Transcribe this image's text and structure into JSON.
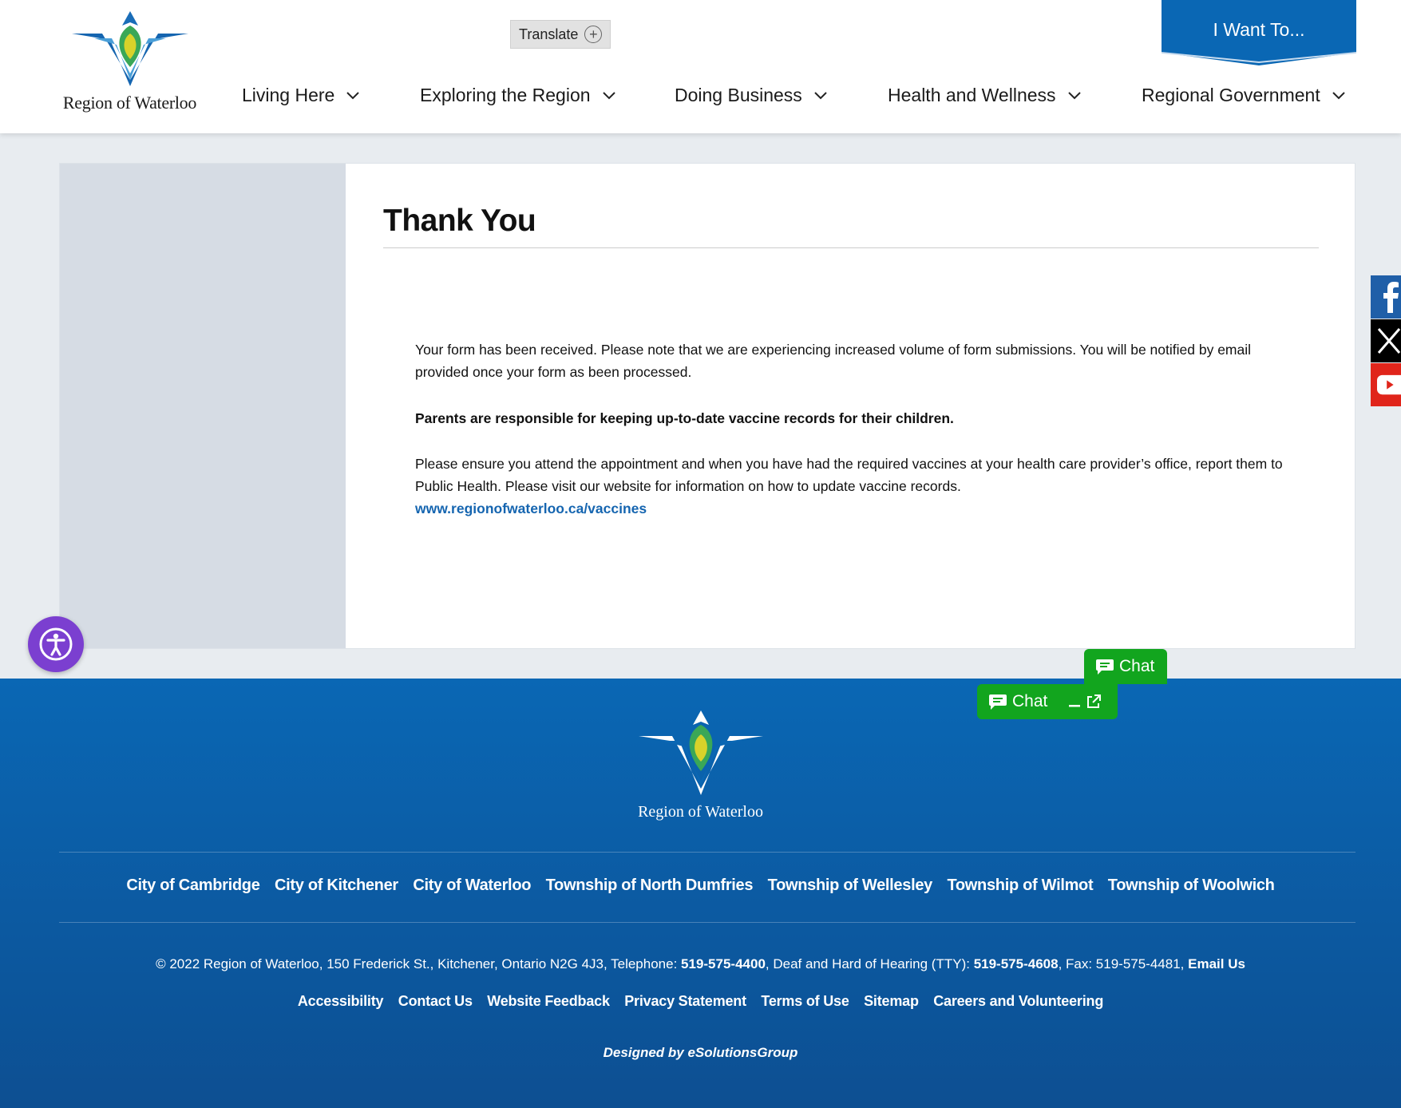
{
  "header": {
    "logo_text": "Region of Waterloo",
    "translate_label": "Translate",
    "i_want_label": "I Want To...",
    "nav": [
      {
        "label": "Living Here"
      },
      {
        "label": "Exploring the Region"
      },
      {
        "label": "Doing Business"
      },
      {
        "label": "Health and Wellness"
      },
      {
        "label": "Regional Government"
      }
    ]
  },
  "main": {
    "title": "Thank You",
    "paragraph1": "Your form has been received. Please note that we are experiencing increased volume of form submissions. You will be notified by email provided once your form as been processed.",
    "paragraph2": "Parents are responsible for keeping up-to-date vaccine records for their children.",
    "paragraph3": "Please ensure you attend the appointment and when you have had the required vaccines at your health care provider’s office, report them to Public Health. Please visit our website for information on how to update vaccine records.",
    "link": "www.regionofwaterloo.ca/vaccines"
  },
  "social": [
    {
      "icon": "facebook-icon",
      "color": "#1f5fa8"
    },
    {
      "icon": "x-icon",
      "color": "#000000"
    },
    {
      "icon": "youtube-icon",
      "color": "#e0251b"
    }
  ],
  "chat": {
    "label_top": "Chat",
    "label_bottom": "Chat"
  },
  "footer": {
    "logo_text": "Region of Waterloo",
    "municipalities": [
      "City of Cambridge",
      "City of Kitchener",
      "City of Waterloo",
      "Township of North Dumfries",
      "Township of Wellesley",
      "Township of Wilmot",
      "Township of Woolwich"
    ],
    "address": {
      "prefix": "© 2022 Region of Waterloo, 150 Frederick St., Kitchener, Ontario N2G 4J3, Telephone: ",
      "phone": "519-575-4400",
      "tty_label": ",  Deaf and Hard of Hearing (TTY): ",
      "tty": "519-575-4608",
      "fax": ", Fax: 519-575-4481, ",
      "email": "Email Us"
    },
    "links": [
      "Accessibility",
      "Contact Us",
      "Website Feedback",
      "Privacy Statement",
      "Terms of Use",
      "Sitemap",
      "Careers and Volunteering"
    ],
    "designed_by": "Designed by eSolutionsGroup"
  },
  "colors": {
    "brand_blue": "#0a67b4",
    "chat_green": "#12a51e",
    "a11y_purple": "#7b3fd0",
    "link_blue": "#1565b0"
  }
}
